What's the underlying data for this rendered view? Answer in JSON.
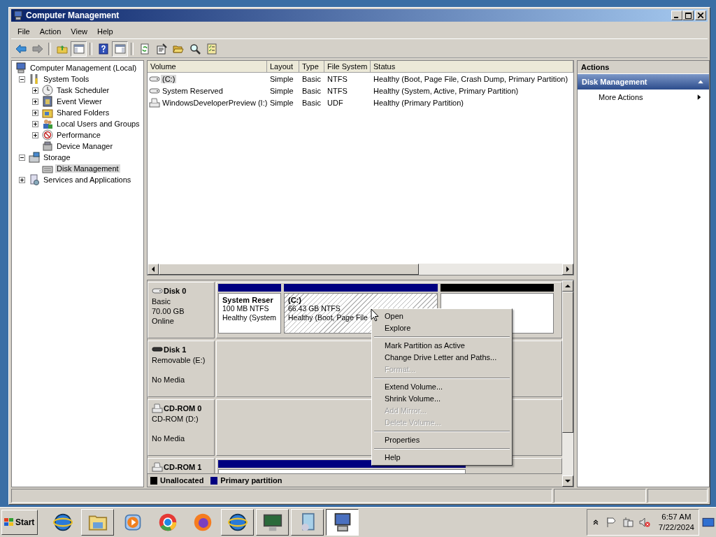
{
  "window": {
    "title": "Computer Management"
  },
  "menu": [
    "File",
    "Action",
    "View",
    "Help"
  ],
  "toolbar": [
    {
      "pressed": false
    },
    {
      "pressed": false
    },
    {
      "pressed": false
    },
    {
      "pressed": true
    },
    {
      "pressed": false
    },
    {
      "pressed": true
    },
    {
      "pressed": false
    },
    {
      "pressed": false
    },
    {
      "pressed": false
    },
    {
      "pressed": false
    },
    {
      "pressed": false
    }
  ],
  "tree": [
    {
      "label": "Computer Management (Local)",
      "selected": false,
      "children": [
        {
          "label": "System Tools",
          "selected": false,
          "expanded": true,
          "children": [
            {
              "label": "Task Scheduler",
              "selected": false,
              "expanded": false
            },
            {
              "label": "Event Viewer",
              "selected": false,
              "expanded": false
            },
            {
              "label": "Shared Folders",
              "selected": false,
              "expanded": false
            },
            {
              "label": "Local Users and Groups",
              "selected": false,
              "expanded": false
            },
            {
              "label": "Performance",
              "selected": false,
              "expanded": false
            },
            {
              "label": "Device Manager",
              "selected": false
            }
          ]
        },
        {
          "label": "Storage",
          "selected": false,
          "expanded": true,
          "children": [
            {
              "label": "Disk Management",
              "selected": true
            }
          ]
        },
        {
          "label": "Services and Applications",
          "selected": false,
          "expanded": false
        }
      ]
    }
  ],
  "volumes": {
    "columns": [
      "Volume",
      "Layout",
      "Type",
      "File System",
      "Status"
    ],
    "rows": [
      {
        "selected": true,
        "cells": [
          "(C:)",
          "Simple",
          "Basic",
          "NTFS",
          "Healthy (Boot, Page File, Crash Dump, Primary Partition)"
        ]
      },
      {
        "selected": false,
        "cells": [
          "System Reserved",
          "Simple",
          "Basic",
          "NTFS",
          "Healthy (System, Active, Primary Partition)"
        ]
      },
      {
        "selected": false,
        "cells": [
          "WindowsDeveloperPreview (I:)",
          "Simple",
          "Basic",
          "UDF",
          "Healthy (Primary Partition)"
        ]
      }
    ]
  },
  "disks": [
    {
      "kind": "disk",
      "name": "Disk 0",
      "lines": [
        "Basic",
        "70.00 GB"
      ],
      "status": "Online",
      "partitions": [
        {
          "kind": "primary",
          "selected": false,
          "name": "System Reser",
          "lines": [
            "100 MB NTFS",
            "Healthy (System"
          ]
        },
        {
          "kind": "primary",
          "selected": true,
          "name": "(C:)",
          "lines": [
            "66.43 GB NTFS",
            "Healthy (Boot, Page File"
          ]
        },
        {
          "kind": "unallocated",
          "selected": false
        }
      ]
    },
    {
      "kind": "removable",
      "name": "Disk 1",
      "lines": [
        "Removable (E:)"
      ],
      "status": "No Media"
    },
    {
      "kind": "cdrom",
      "name": "CD-ROM 0",
      "lines": [
        "CD-ROM (D:)"
      ],
      "status": "No Media"
    },
    {
      "kind": "cdrom",
      "name": "CD-ROM 1",
      "partitions": [
        {
          "kind": "primary",
          "selected": false
        }
      ]
    }
  ],
  "legend": [
    {
      "kind": "unallocated",
      "label": "Unallocated",
      "color": "#000000"
    },
    {
      "kind": "primary",
      "label": "Primary partition",
      "color": "#000080"
    }
  ],
  "actions": {
    "header": "Actions",
    "sections": [
      {
        "title": "Disk Management",
        "expanded": true,
        "items": [
          {
            "label": "More Actions",
            "submenu": true
          }
        ]
      }
    ]
  },
  "context_menu": [
    {
      "kind": "item",
      "label": "Open",
      "disabled": false
    },
    {
      "kind": "item",
      "label": "Explore",
      "disabled": false
    },
    {
      "kind": "separator"
    },
    {
      "kind": "item",
      "label": "Mark Partition as Active",
      "disabled": false
    },
    {
      "kind": "item",
      "label": "Change Drive Letter and Paths...",
      "disabled": false
    },
    {
      "kind": "item",
      "label": "Format...",
      "disabled": true
    },
    {
      "kind": "separator"
    },
    {
      "kind": "item",
      "label": "Extend Volume...",
      "disabled": false
    },
    {
      "kind": "item",
      "label": "Shrink Volume...",
      "disabled": false
    },
    {
      "kind": "item",
      "label": "Add Mirror...",
      "disabled": true
    },
    {
      "kind": "item",
      "label": "Delete Volume...",
      "disabled": true
    },
    {
      "kind": "separator"
    },
    {
      "kind": "item",
      "label": "Properties",
      "disabled": false
    },
    {
      "kind": "separator"
    },
    {
      "kind": "item",
      "label": "Help",
      "disabled": false
    }
  ],
  "taskbar": {
    "start": "Start",
    "apps": [
      {
        "running": false,
        "selected": false
      },
      {
        "running": true,
        "selected": false
      },
      {
        "running": false,
        "selected": false
      },
      {
        "running": false,
        "selected": false
      },
      {
        "running": false,
        "selected": false
      },
      {
        "running": true,
        "selected": false
      },
      {
        "running": true,
        "selected": false
      },
      {
        "running": true,
        "selected": false
      },
      {
        "running": true,
        "selected": true
      }
    ],
    "clock": {
      "time": "6:57 AM",
      "date": "7/22/2024"
    }
  }
}
